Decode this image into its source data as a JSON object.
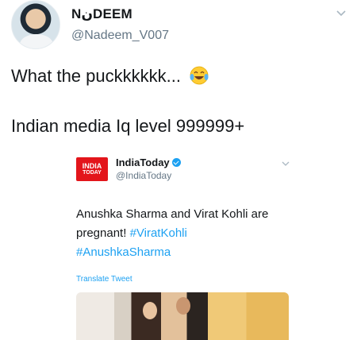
{
  "tweet": {
    "user_name": "NنDEEM",
    "handle": "@Nadeem_V007",
    "line1": "What the puckkkkkk...",
    "emoji": "laughing-crying-emoji",
    "line2": "Indian media Iq level 999999+"
  },
  "embedded": {
    "logo_top": "INDIA",
    "logo_bottom": "TODAY",
    "name": "IndiaToday",
    "handle": "@IndiaToday",
    "text": "Anushka Sharma and Virat Kohli are pregnant!",
    "hashtag1": "#ViratKohli",
    "hashtag2": "#AnushkaSharma",
    "translate": "Translate Tweet"
  },
  "colors": {
    "link": "#1da1f2",
    "muted": "#657786",
    "text": "#14171a",
    "logo": "#e3151b"
  }
}
